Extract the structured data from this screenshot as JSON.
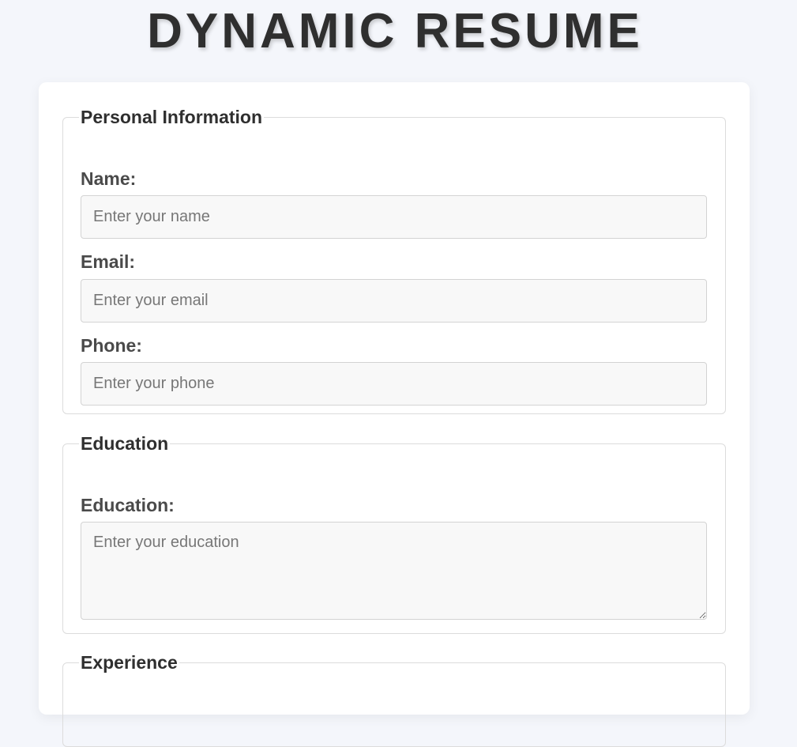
{
  "page": {
    "title": "DYNAMIC RESUME"
  },
  "personal": {
    "legend": "Personal Information",
    "name_label": "Name:",
    "name_placeholder": "Enter your name",
    "email_label": "Email:",
    "email_placeholder": "Enter your email",
    "phone_label": "Phone:",
    "phone_placeholder": "Enter your phone"
  },
  "education": {
    "legend": "Education",
    "label": "Education:",
    "placeholder": "Enter your education"
  },
  "experience": {
    "legend": "Experience"
  },
  "colors": {
    "background": "#f4f6fb",
    "card": "#ffffff",
    "input_background": "#f8f8f8",
    "heading_text": "#2f2f2f",
    "label_text": "#4a4a4a",
    "border": "#dcdcdc"
  }
}
